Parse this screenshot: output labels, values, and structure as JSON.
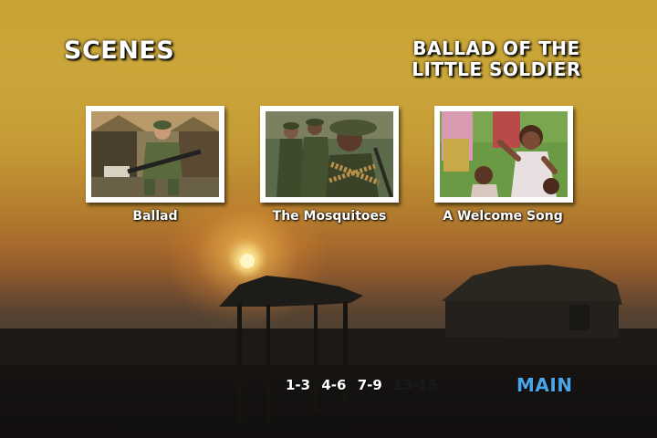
{
  "menu": {
    "section_title": "SCENES",
    "film_title_line1": "BALLAD OF THE",
    "film_title_line2": "LITTLE SOLDIER"
  },
  "scenes": [
    {
      "label": "Ballad",
      "image": "soldier-seated-with-rifle"
    },
    {
      "label": "The Mosquitoes",
      "image": "armed-youth-soldiers"
    },
    {
      "label": "A Welcome Song",
      "image": "girl-clapping-singing"
    }
  ],
  "page_nav": {
    "pages": [
      "1-3",
      "4-6",
      "7-9",
      "13-15"
    ],
    "current": "13-15"
  },
  "main_link": "MAIN",
  "colors": {
    "main_link": "#4aa6e8",
    "active_page": "#1a1a1a",
    "text": "#ffffff"
  }
}
